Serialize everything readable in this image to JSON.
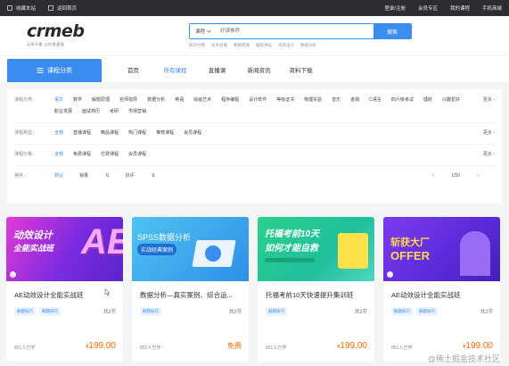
{
  "topbar": {
    "favorite": "收藏本站",
    "home": "返回首页",
    "links": [
      "登录/注册",
      "会员专区",
      "我的课程",
      "手机商城"
    ]
  },
  "logo": {
    "text": "crmeb",
    "subtitle": "无所不能 让你变更强"
  },
  "search": {
    "category": "课程",
    "placeholder": "好课推荐",
    "button": "搜索",
    "hot": [
      "知识付费",
      "技术前端",
      "物联网测",
      "编程讲坛",
      "项目设计",
      "数据分析"
    ]
  },
  "nav": {
    "category_button": "课程分类",
    "links": [
      "首页",
      "所有课程",
      "直播课",
      "新闻资讯",
      "资料下载"
    ],
    "active_index": 1
  },
  "filters": {
    "category": {
      "label": "课程分类：",
      "values": [
        "语文",
        "数学",
        "解题原理",
        "名师指导",
        "数据分析",
        "英语",
        "绘画艺术",
        "程序编程",
        "设计软件",
        "等级证书",
        "物理实验",
        "音乐",
        "金融",
        "C语言",
        "四六级考试",
        "理财",
        "兴趣爱好",
        "职业发展",
        "面试简历",
        "考研",
        "市场营销"
      ],
      "selected": 0,
      "more": "更多"
    },
    "type": {
      "label": "课程类型：",
      "values": [
        "全部",
        "直播课程",
        "精品课程",
        "热门课程",
        "推荐课程",
        "会员课程"
      ],
      "selected": 0,
      "more": "更多"
    },
    "price": {
      "label": "课程价格：",
      "values": [
        "全部",
        "免费课程",
        "付费课程",
        "会员课程"
      ],
      "selected": 0,
      "more": "更多"
    },
    "sort": {
      "label": "排序：",
      "values": [
        "默认",
        "销量",
        "好评"
      ],
      "selected": 0,
      "page": "1/50"
    }
  },
  "cards": [
    {
      "thumb_title": "动效设计",
      "thumb_sub": "全能实战班",
      "thumb_big": "AE",
      "title": "AE动效设计全能实战班",
      "tags": [
        "解题技巧",
        "解题技巧"
      ],
      "count": "共2节",
      "learners": "851人已学",
      "price_symbol": "¥",
      "price": "199.00",
      "free": false
    },
    {
      "thumb_title": "SPSS数据分析",
      "thumb_sub": "实战经典案例",
      "thumb_big": "",
      "title": "数据分析—真实案例、综合运...",
      "tags": [
        "解题技巧"
      ],
      "count": "共2节",
      "learners": "851人已学",
      "price": "免费",
      "free": true
    },
    {
      "thumb_title": "托福考前10天",
      "thumb_sub": "如何才能自救",
      "thumb_big": "",
      "title": "托福考前10天快速提升集训班",
      "tags": [
        "解题技巧"
      ],
      "count": "共2节",
      "learners": "851人已学",
      "price_symbol": "¥",
      "price": "199.00",
      "free": false
    },
    {
      "thumb_title": "斩获大厂",
      "thumb_sub": "OFFER",
      "thumb_big": "",
      "title": "AE动效设计全能实战班",
      "tags": [
        "解题技巧",
        "解题技巧"
      ],
      "count": "共2节",
      "learners": "851人已学",
      "price_symbol": "¥",
      "price": "199.00",
      "free": false
    }
  ],
  "watermark": "@稀土掘金技术社区",
  "colors": {
    "accent": "#3b8cf0",
    "price": "#ff6a00",
    "topbar": "#2b2d33"
  }
}
